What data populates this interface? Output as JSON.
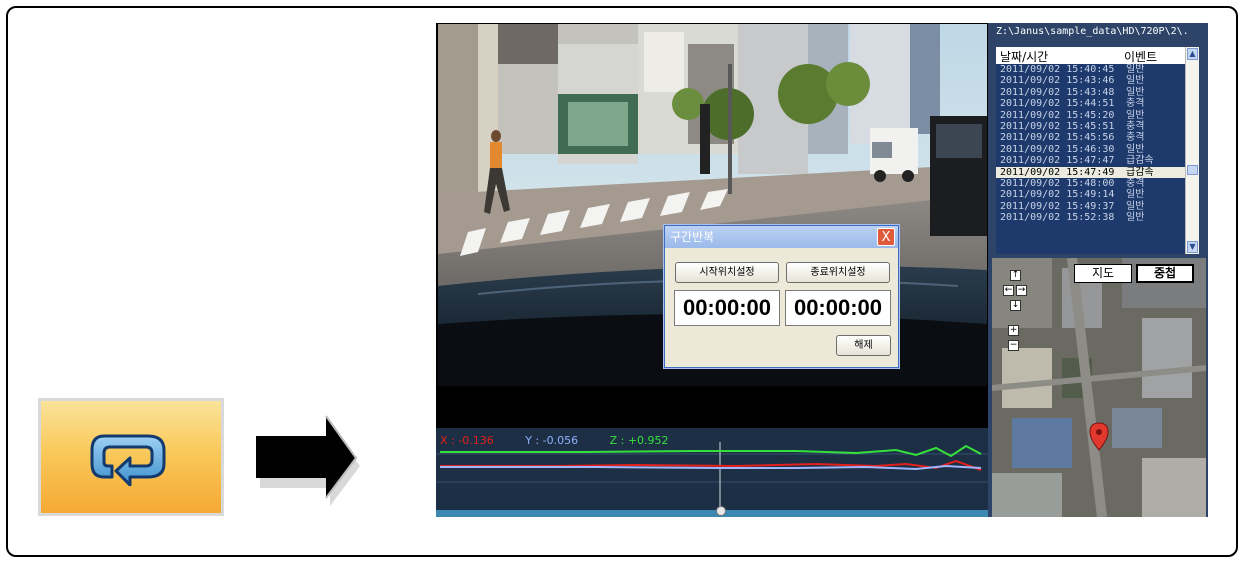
{
  "dialog": {
    "title": "구간반복",
    "close_label": "X",
    "start_button": "시작위치설정",
    "end_button": "종료위치설정",
    "start_time": "00:00:00",
    "end_time": "00:00:00",
    "release_button": "해제"
  },
  "graph": {
    "x_label": "X : -0.136",
    "y_label": "Y : -0.056",
    "z_label": "Z : +0.952",
    "x_color": "#e2201c",
    "y_color": "#8fb0ff",
    "z_color": "#36e03a"
  },
  "file": {
    "path": "Z:\\Janus\\sample_data\\HD\\720P\\2\\..."
  },
  "event_list": {
    "col_datetime": "날짜/시간",
    "col_event": "이벤트",
    "rows": [
      {
        "datetime": "2011/09/02 15:40:45",
        "event": "일반"
      },
      {
        "datetime": "2011/09/02 15:43:46",
        "event": "일반"
      },
      {
        "datetime": "2011/09/02 15:43:48",
        "event": "일반"
      },
      {
        "datetime": "2011/09/02 15:44:51",
        "event": "충격"
      },
      {
        "datetime": "2011/09/02 15:45:20",
        "event": "일반"
      },
      {
        "datetime": "2011/09/02 15:45:51",
        "event": "충격"
      },
      {
        "datetime": "2011/09/02 15:45:56",
        "event": "충격"
      },
      {
        "datetime": "2011/09/02 15:46:30",
        "event": "일반"
      },
      {
        "datetime": "2011/09/02 15:47:47",
        "event": "급감속"
      },
      {
        "datetime": "2011/09/02 15:47:49",
        "event": "급감속"
      },
      {
        "datetime": "2011/09/02 15:48:00",
        "event": "충격"
      },
      {
        "datetime": "2011/09/02 15:49:14",
        "event": "일반"
      },
      {
        "datetime": "2011/09/02 15:49:37",
        "event": "일반"
      },
      {
        "datetime": "2011/09/02 15:52:38",
        "event": "일반"
      }
    ],
    "selected_index": 9
  },
  "map": {
    "map_button": "지도",
    "overlay_button": "중첩",
    "up": "↑",
    "down": "↓",
    "left": "←",
    "right": "→",
    "zoom_in": "+",
    "zoom_out": "−"
  },
  "colors": {
    "repeat_button": "#f9c95b",
    "panel_bg": "#2d4468",
    "list_bg": "#1e3a6c",
    "graph_bg": "#1c2f45"
  }
}
